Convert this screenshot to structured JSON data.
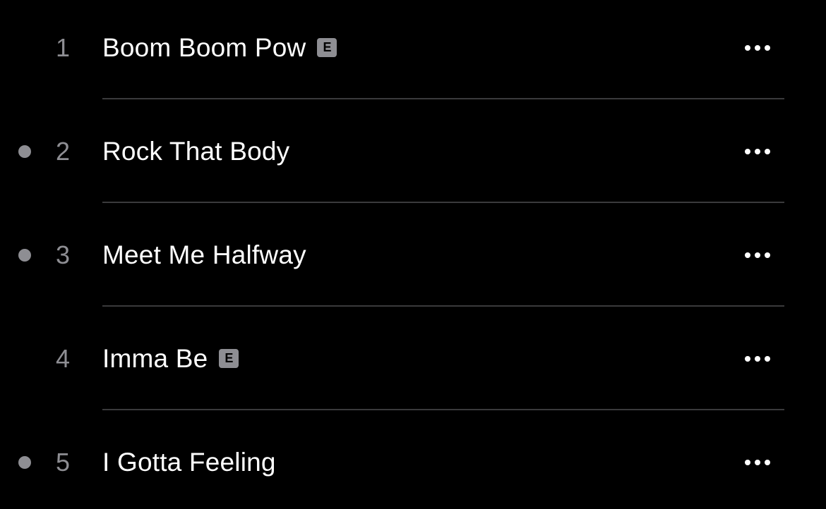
{
  "colors": {
    "background": "#000000",
    "title": "#ffffff",
    "secondary": "#8e8e93",
    "separator": "#3a3a3c"
  },
  "tracks": [
    {
      "number": "1",
      "title": "Boom Boom Pow",
      "explicit": true,
      "explicit_label": "E",
      "dot": false,
      "more_icon": "ellipsis-icon"
    },
    {
      "number": "2",
      "title": "Rock That Body",
      "explicit": false,
      "explicit_label": "",
      "dot": true,
      "more_icon": "ellipsis-icon"
    },
    {
      "number": "3",
      "title": "Meet Me Halfway",
      "explicit": false,
      "explicit_label": "",
      "dot": true,
      "more_icon": "ellipsis-icon"
    },
    {
      "number": "4",
      "title": "Imma Be",
      "explicit": true,
      "explicit_label": "E",
      "dot": false,
      "more_icon": "ellipsis-icon"
    },
    {
      "number": "5",
      "title": "I Gotta Feeling",
      "explicit": false,
      "explicit_label": "",
      "dot": true,
      "more_icon": "ellipsis-icon"
    }
  ]
}
